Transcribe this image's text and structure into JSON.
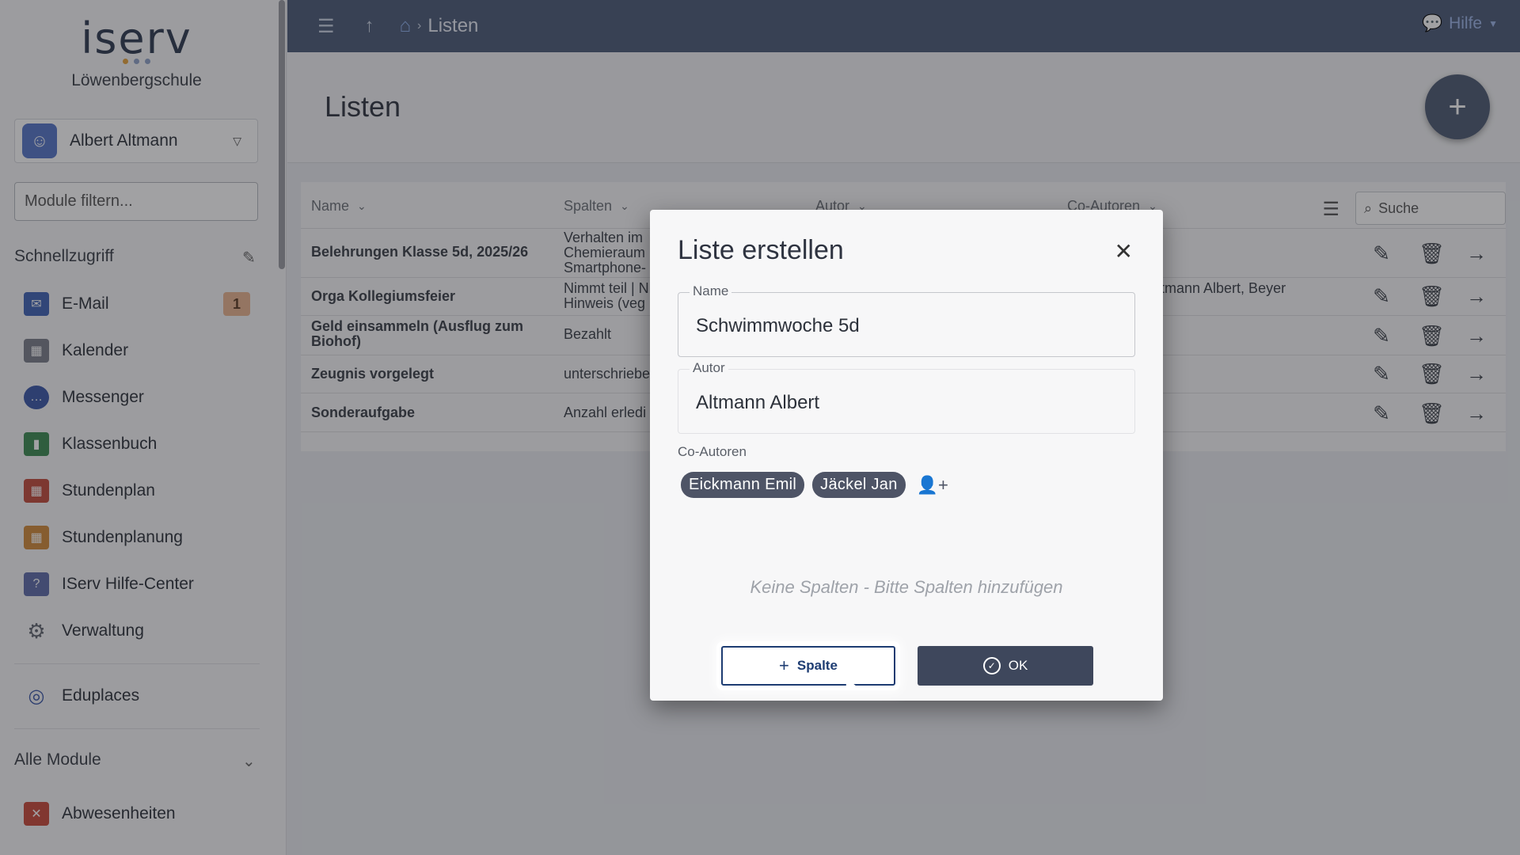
{
  "sidebar": {
    "logo": "iserv",
    "school": "Löwenbergschule",
    "user": {
      "name": "Albert Altmann"
    },
    "filter_placeholder": "Module filtern...",
    "quick_access": "Schnellzugriff",
    "items": [
      {
        "label": "E-Mail",
        "icon": "mail-icon",
        "color": "#3f63b5",
        "badge": "1"
      },
      {
        "label": "Kalender",
        "icon": "calendar-icon",
        "color": "#7a7f8a"
      },
      {
        "label": "Messenger",
        "icon": "chat-icon",
        "color": "#3a57a8"
      },
      {
        "label": "Klassenbuch",
        "icon": "book-icon",
        "color": "#3c8a52"
      },
      {
        "label": "Stundenplan",
        "icon": "timetable-icon",
        "color": "#c24a3c"
      },
      {
        "label": "Stundenplanung",
        "icon": "planning-icon",
        "color": "#d08a3a"
      },
      {
        "label": "IServ Hilfe-Center",
        "icon": "help-center-icon",
        "color": "#5d6caa"
      },
      {
        "label": "Verwaltung",
        "icon": "gear-icon",
        "color": "#5f646e"
      }
    ],
    "eduplaces": "Eduplaces",
    "all_modules": "Alle Module",
    "more_items": [
      {
        "label": "Abwesenheiten",
        "icon": "absence-icon",
        "color": "#c8493a"
      }
    ]
  },
  "topbar": {
    "breadcrumb": "Listen",
    "help": "Hilfe"
  },
  "page": {
    "title": "Listen",
    "table": {
      "headers": {
        "name": "Name",
        "columns": "Spalten",
        "author": "Autor",
        "coauthors": "Co-Autoren"
      },
      "search_placeholder": "Suche",
      "rows": [
        {
          "name": "Belehrungen Klasse 5d, 2025/26",
          "cols": [
            "Verhalten im",
            "Chemieraum",
            "Smartphone-"
          ],
          "co": ""
        },
        {
          "name": "Orga Kollegiumsfeier",
          "cols": [
            "Nimmt teil | N",
            "Hinweis (veg"
          ],
          "co": "ltmann Albert, Beyer"
        },
        {
          "name_lines": [
            "Geld einsammeln (Ausflug zum",
            "Biohof)"
          ],
          "cols": [
            "Bezahlt"
          ],
          "co": ""
        },
        {
          "name": "Zeugnis vorgelegt",
          "cols": [
            "unterschriebe"
          ],
          "co": ""
        },
        {
          "name": "Sonderaufgabe",
          "cols": [
            "Anzahl erledi"
          ],
          "co": ""
        }
      ]
    }
  },
  "modal": {
    "title": "Liste erstellen",
    "name_label": "Name",
    "name_value": "Schwimmwoche 5d",
    "author_label": "Autor",
    "author_value": "Altmann Albert",
    "coauthors_label": "Co-Autoren",
    "coauthors": [
      "Eickmann Emil",
      "Jäckel Jan"
    ],
    "empty_message": "Keine Spalten - Bitte Spalten hinzufügen",
    "add_column_label": "Spalte",
    "ok_label": "OK"
  }
}
